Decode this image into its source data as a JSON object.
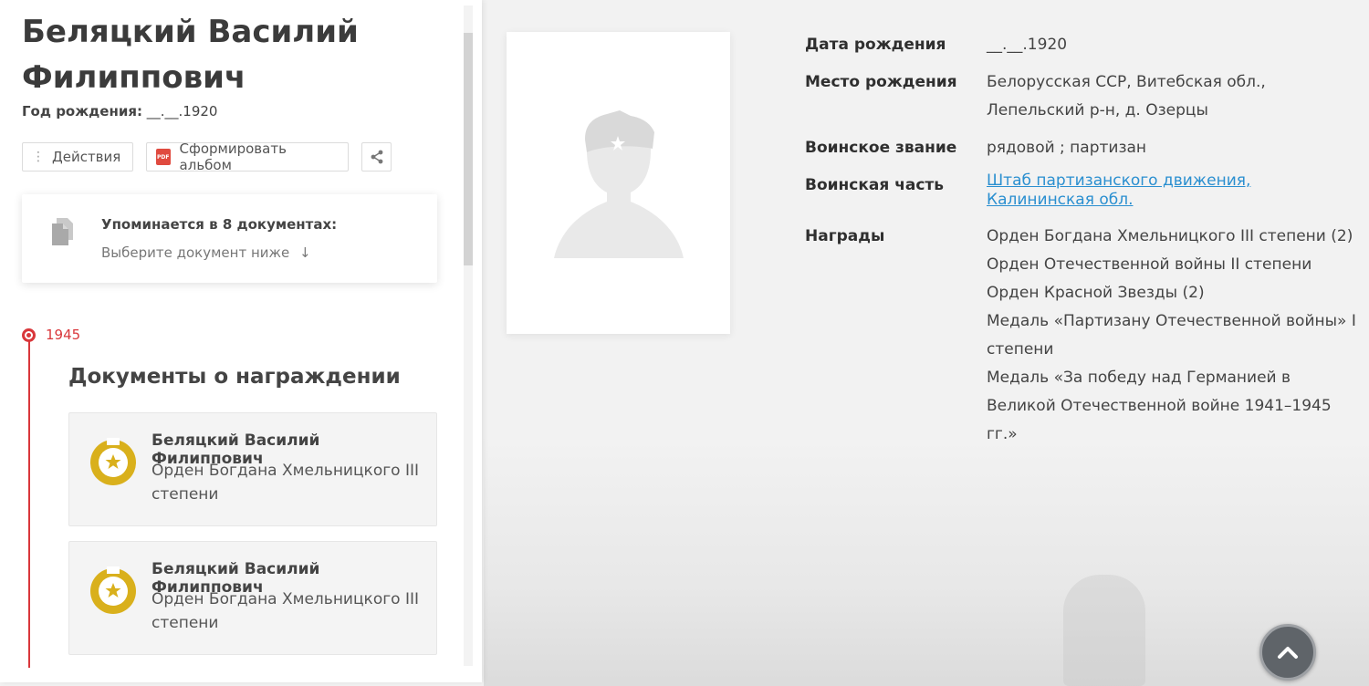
{
  "person": {
    "full_name": "Беляцкий Василий Филиппович",
    "birth_year_label": "Год рождения:",
    "birth_year_value": "__.__.1920"
  },
  "actions": {
    "actions_label": "Действия",
    "album_label": "Сформировать альбом",
    "pdf_icon_text": "PDF"
  },
  "documents": {
    "title": "Упоминается в 8 документах:",
    "subtitle": "Выберите документ ниже",
    "arrow": "↓"
  },
  "timeline": {
    "year": "1945",
    "section_title": "Документы о награждении",
    "cards": [
      {
        "person": "Беляцкий Василий Филиппович",
        "award": "Орден Богдана Хмельницкого III степени"
      },
      {
        "person": "Беляцкий Василий Филиппович",
        "award": "Орден Богдана Хмельницкого III степени"
      }
    ]
  },
  "info": {
    "birth_date_label": "Дата рождения",
    "birth_date_value": "__.__.1920",
    "birth_place_label": "Место рождения",
    "birth_place_value": "Белорусская ССР, Витебская обл., Лепельский р-н, д. Озерцы",
    "rank_label": "Воинское звание",
    "rank_value": "рядовой ; партизан",
    "unit_label": "Воинская часть",
    "unit_value": "Штаб партизанского движения, Калининская обл.",
    "awards_label": "Награды",
    "awards": [
      "Орден Богдана Хмельницкого III степени (2)",
      "Орден Отечественной войны II степени",
      "Орден Красной Звезды (2)",
      "Медаль «Партизану Отечественной войны» I степени",
      "Медаль «За победу над Германией в Великой Отечественной войне 1941–1945 гг.»"
    ]
  },
  "colors": {
    "accent_red": "#d9373b",
    "link_blue": "#2a8fd0",
    "medal_gold": "#d9b01c"
  },
  "icons": {
    "scroll_top": "chevron-up-icon",
    "share": "share-icon",
    "documents": "documents-icon",
    "medal": "medal-icon",
    "avatar": "soldier-avatar-icon"
  }
}
